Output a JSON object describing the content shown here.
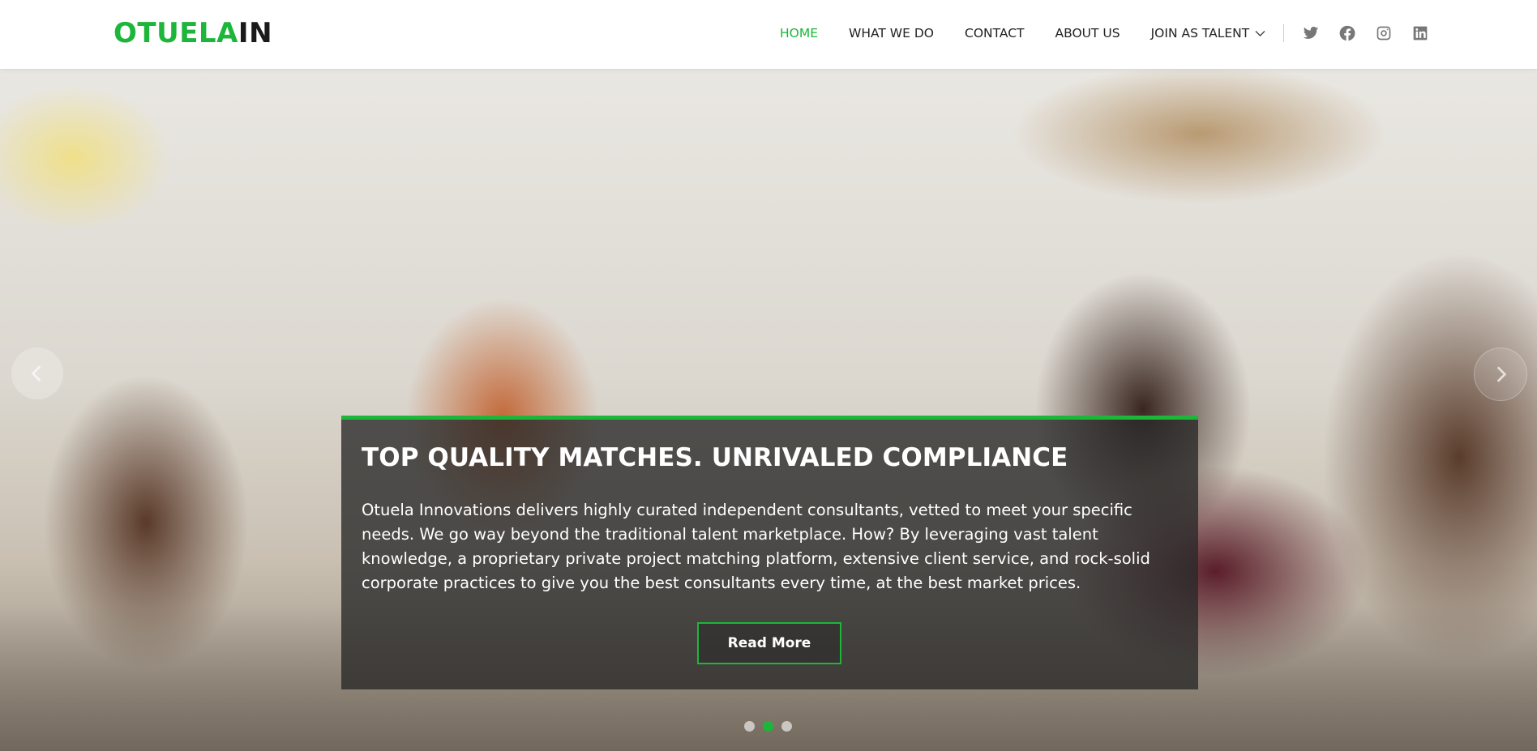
{
  "logo": {
    "part1": "OTUELA",
    "part2": "IN"
  },
  "nav": {
    "items": [
      {
        "label": "HOME",
        "active": true
      },
      {
        "label": "WHAT WE DO"
      },
      {
        "label": "CONTACT"
      },
      {
        "label": "ABOUT US"
      },
      {
        "label": "JOIN AS TALENT",
        "dropdown": true
      }
    ],
    "social": [
      "twitter-icon",
      "facebook-icon",
      "instagram-icon",
      "linkedin-icon"
    ]
  },
  "hero": {
    "title": "TOP QUALITY MATCHES. UNRIVALED COMPLIANCE",
    "text": "Otuela Innovations delivers highly curated independent consultants, vetted to meet your specific needs. We go way beyond the traditional talent marketplace. How? By leveraging vast talent knowledge, a proprietary private project matching platform, extensive client service, and rock-solid corporate practices to give you the best consultants every time, at the best market prices.",
    "button": "Read More",
    "slides": 3,
    "active_slide": 2
  },
  "colors": {
    "accent": "#1db63b",
    "text_dark": "#222222"
  }
}
